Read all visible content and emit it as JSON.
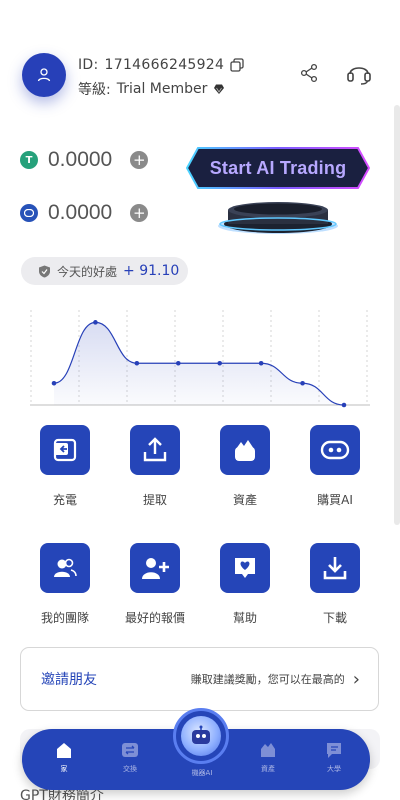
{
  "user": {
    "id_label": "ID:",
    "id_value": "1714666245924",
    "level_label": "等級:",
    "level_value": "Trial Member"
  },
  "balances": [
    {
      "coin": "USDT",
      "color": "#26a17b",
      "value": "0.0000"
    },
    {
      "coin": "USDC",
      "color": "#2752b8",
      "value": "0.0000"
    }
  ],
  "ai_banner": {
    "label": "Start AI Trading"
  },
  "benefit": {
    "label": "今天的好處",
    "amount": "+ 91.10"
  },
  "chart_data": {
    "type": "line",
    "values": [
      0.25,
      0.95,
      0.48,
      0.48,
      0.48,
      0.48,
      0.25,
      0.0
    ],
    "ylim": [
      0,
      1
    ],
    "grid": true,
    "series_color": "#2740b8"
  },
  "grid": [
    {
      "label": "充電",
      "icon": "wallet-icon"
    },
    {
      "label": "提取",
      "icon": "upload-icon"
    },
    {
      "label": "資產",
      "icon": "asset-icon"
    },
    {
      "label": "購買AI",
      "icon": "robot-icon"
    },
    {
      "label": "我的團隊",
      "icon": "team-icon"
    },
    {
      "label": "最好的報價",
      "icon": "add-user-icon"
    },
    {
      "label": "幫助",
      "icon": "help-heart-icon"
    },
    {
      "label": "下載",
      "icon": "download-icon"
    }
  ],
  "invite": {
    "title": "邀請朋友",
    "description": "賺取建議獎勵，您可以在最高的"
  },
  "footer_peek": "GPT財務簡介",
  "nav": {
    "items": [
      {
        "label": "家",
        "icon": "home-icon",
        "active": true
      },
      {
        "label": "交換",
        "icon": "exchange-icon",
        "active": false
      },
      {
        "label": "機器AI",
        "icon": "robot-ai-icon",
        "active": false
      },
      {
        "label": "資產",
        "icon": "asset-nav-icon",
        "active": false
      },
      {
        "label": "大學",
        "icon": "chat-icon",
        "active": false
      }
    ]
  }
}
